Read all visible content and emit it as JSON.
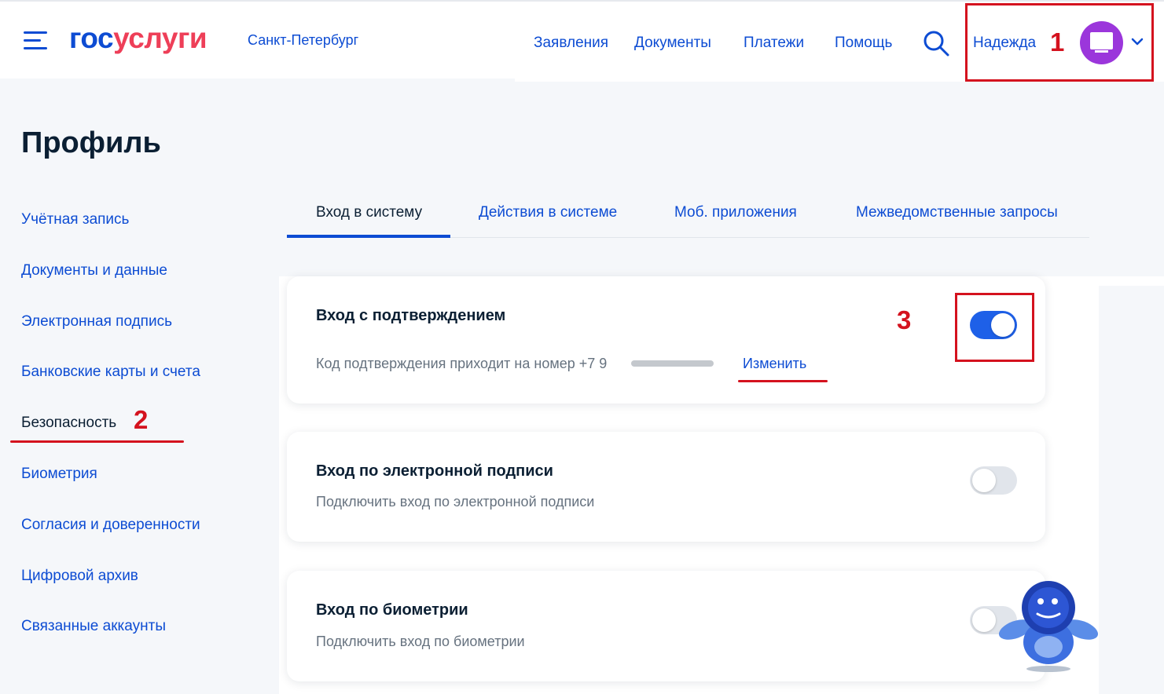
{
  "header": {
    "logo_part1": "гос",
    "logo_part2": "услуги",
    "city": "Санкт-Петербург",
    "nav": [
      "Заявления",
      "Документы",
      "Платежи",
      "Помощь"
    ],
    "user_name": "Надежда"
  },
  "annotations": {
    "a1": "1",
    "a2": "2",
    "a3": "3"
  },
  "page_title": "Профиль",
  "sidebar": [
    "Учётная запись",
    "Документы и данные",
    "Электронная подпись",
    "Банковские карты и счета",
    "Безопасность",
    "Биометрия",
    "Согласия и доверенности",
    "Цифровой архив",
    "Связанные аккаунты"
  ],
  "sidebar_active": "Безопасность",
  "tabs": [
    "Вход в систему",
    "Действия в системе",
    "Моб. приложения",
    "Межведомственные запросы"
  ],
  "cards": {
    "confirm": {
      "title": "Вход с подтверждением",
      "subtitle": "Код подтверждения приходит на номер +7 9",
      "link": "Изменить",
      "enabled": true
    },
    "esign": {
      "title": "Вход по электронной подписи",
      "subtitle": "Подключить вход по электронной подписи",
      "enabled": false
    },
    "biometrics": {
      "title": "Вход по биометрии",
      "subtitle": "Подключить вход по биометрии",
      "enabled": false
    }
  },
  "colors": {
    "brand_blue": "#0d4cd3",
    "brand_red": "#ee3f58",
    "annotation_red": "#d4121e",
    "avatar": "#9b36db",
    "toggle_on": "#1e60e8"
  }
}
